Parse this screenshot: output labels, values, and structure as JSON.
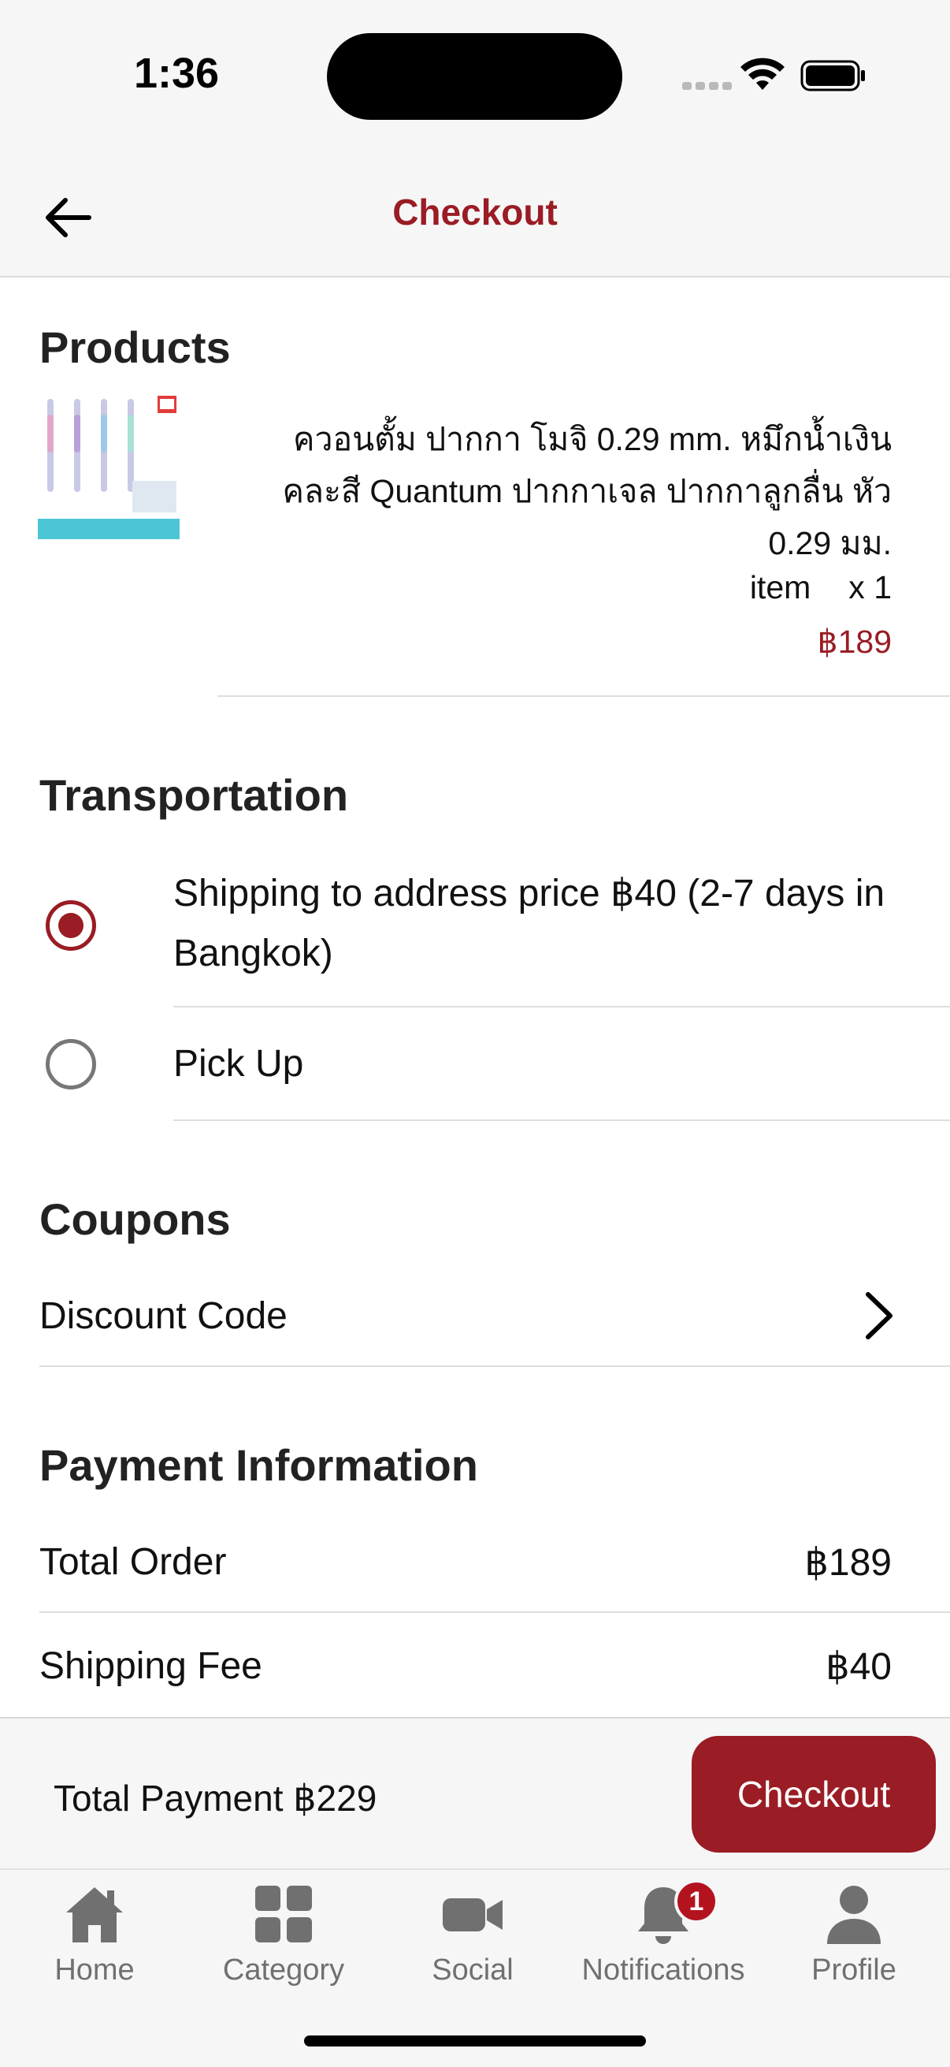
{
  "status_bar": {
    "time": "1:36"
  },
  "header": {
    "title": "Checkout"
  },
  "products": {
    "heading": "Products",
    "items": [
      {
        "name": "ควอนตั้ม ปากกา โมจิ 0.29 mm. หมึกน้ำเงิน คละสี Quantum ปากกาเจล ปากกาลูกลื่น หัว 0.29 มม.",
        "unit_label": "item",
        "quantity": "x 1",
        "price": "฿189"
      }
    ]
  },
  "transportation": {
    "heading": "Transportation",
    "options": [
      {
        "label": "Shipping to address price ฿40 (2-7 days in Bangkok)",
        "selected": true
      },
      {
        "label": "Pick Up",
        "selected": false
      }
    ]
  },
  "coupons": {
    "heading": "Coupons",
    "discount_label": "Discount Code"
  },
  "payment": {
    "heading": "Payment Information",
    "rows": [
      {
        "label": "Total Order",
        "value": "฿189"
      },
      {
        "label": "Shipping Fee",
        "value": "฿40"
      }
    ]
  },
  "checkout_bar": {
    "total_label": "Total Payment ฿229",
    "button_label": "Checkout"
  },
  "tab_bar": {
    "tabs": [
      {
        "label": "Home",
        "icon": "house-icon"
      },
      {
        "label": "Category",
        "icon": "grid-icon"
      },
      {
        "label": "Social",
        "icon": "video-camera-icon"
      },
      {
        "label": "Notifications",
        "icon": "bell-icon",
        "badge": "1"
      },
      {
        "label": "Profile",
        "icon": "person-icon"
      }
    ]
  },
  "colors": {
    "accent": "#9a1c24",
    "badge": "#b3131f",
    "tab_gray": "#707070"
  }
}
